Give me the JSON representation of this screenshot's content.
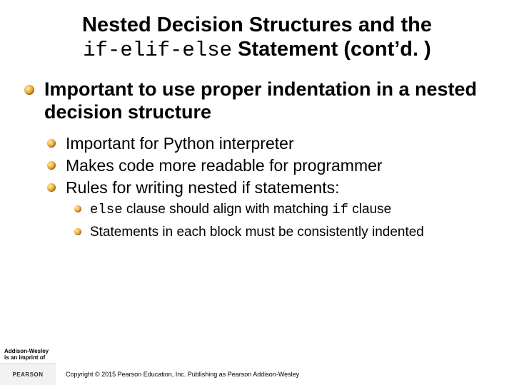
{
  "title": {
    "line1": "Nested Decision Structures and the",
    "code": "if-elif-else",
    "line2_rest": " Statement (cont’d. )"
  },
  "bullets": {
    "l1": "Important to use proper indentation in a nested decision structure",
    "l2a": "Important for Python interpreter",
    "l2b": "Makes code more readable for programmer",
    "l2c": "Rules for writing nested if statements:",
    "l3a_code1": "else",
    "l3a_mid": " clause should align with matching ",
    "l3a_code2": "if",
    "l3a_end": " clause",
    "l3b": "Statements in each block must be consistently indented"
  },
  "footer": {
    "imprint_line1": "Addison-Wesley",
    "imprint_line2": "is an imprint of",
    "logo": "PEARSON",
    "copyright": "Copyright © 2015 Pearson Education, Inc. Publishing as Pearson Addison-Wesley"
  }
}
